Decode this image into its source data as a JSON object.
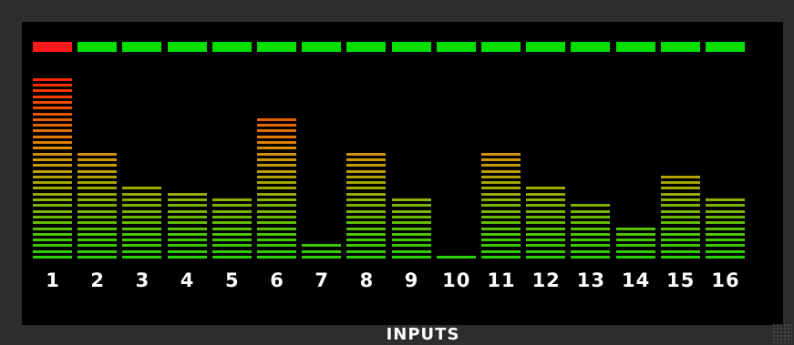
{
  "panel": {
    "title": "INPUTS",
    "colors": {
      "background": "#000000",
      "frame": "#2b2d2f",
      "ok": "#00e000",
      "clip": "#ff1a1a",
      "low": "#28d000",
      "high": "#ff2000"
    }
  },
  "channels": [
    {
      "label": "1",
      "level": 0.995,
      "clip": true
    },
    {
      "label": "2",
      "level": 0.605,
      "clip": false
    },
    {
      "label": "3",
      "level": 0.405,
      "clip": false
    },
    {
      "label": "4",
      "level": 0.375,
      "clip": false
    },
    {
      "label": "5",
      "level": 0.345,
      "clip": false
    },
    {
      "label": "6",
      "level": 0.78,
      "clip": false
    },
    {
      "label": "7",
      "level": 0.085,
      "clip": false
    },
    {
      "label": "8",
      "level": 0.605,
      "clip": false
    },
    {
      "label": "9",
      "level": 0.345,
      "clip": false
    },
    {
      "label": "10",
      "level": 0.02,
      "clip": false
    },
    {
      "label": "11",
      "level": 0.605,
      "clip": false
    },
    {
      "label": "12",
      "level": 0.405,
      "clip": false
    },
    {
      "label": "13",
      "level": 0.3,
      "clip": false
    },
    {
      "label": "14",
      "level": 0.185,
      "clip": false
    },
    {
      "label": "15",
      "level": 0.475,
      "clip": false
    },
    {
      "label": "16",
      "level": 0.345,
      "clip": false
    }
  ]
}
